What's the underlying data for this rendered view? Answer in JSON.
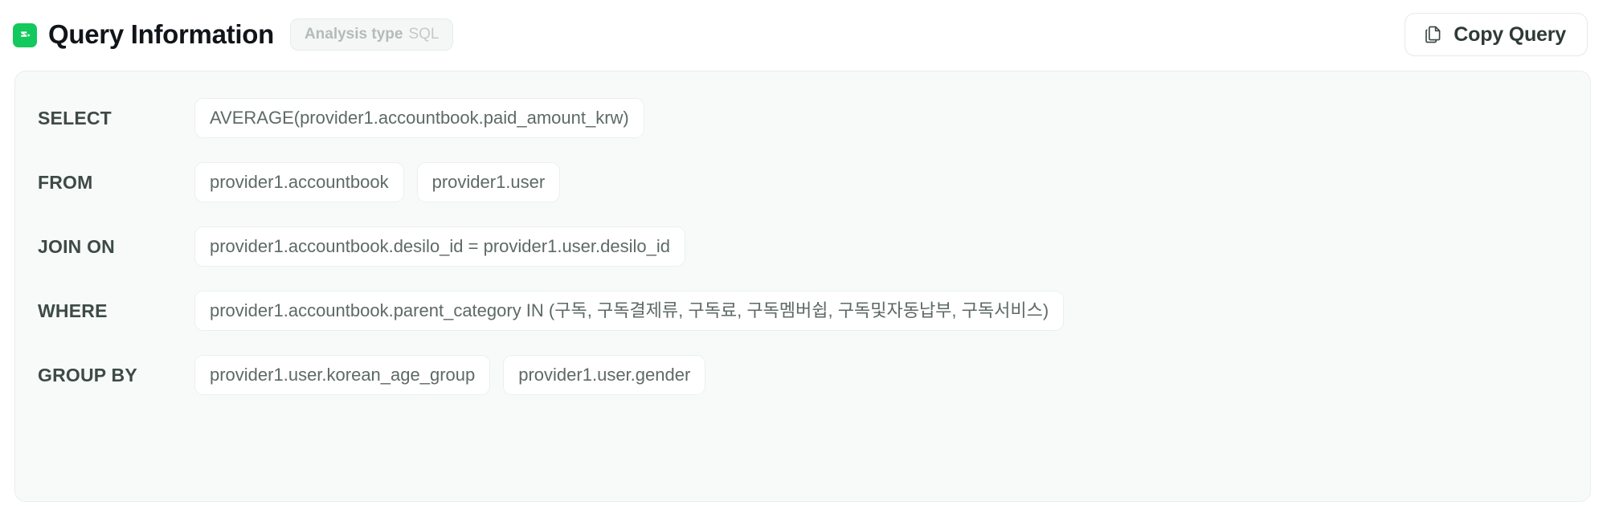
{
  "header": {
    "brand_icon": "query-logo-icon",
    "title": "Query Information",
    "badge": {
      "label": "Analysis type",
      "value": "SQL"
    },
    "copy_button": {
      "icon": "copy-icon",
      "label": "Copy Query"
    }
  },
  "query": {
    "rows": [
      {
        "label": "SELECT",
        "chips": [
          "AVERAGE(provider1.accountbook.paid_amount_krw)"
        ]
      },
      {
        "label": "FROM",
        "chips": [
          "provider1.accountbook",
          "provider1.user"
        ]
      },
      {
        "label": "JOIN ON",
        "chips": [
          "provider1.accountbook.desilo_id = provider1.user.desilo_id"
        ]
      },
      {
        "label": "WHERE",
        "chips": [
          "provider1.accountbook.parent_category IN (구독, 구독결제류, 구독료, 구독멤버쉽, 구독및자동납부, 구독서비스)"
        ]
      },
      {
        "label": "GROUP BY",
        "chips": [
          "provider1.user.korean_age_group",
          "provider1.user.gender"
        ]
      }
    ]
  },
  "colors": {
    "brand_green": "#13c85c",
    "card_bg": "#f7faf9",
    "card_border": "#e7efed",
    "chip_bg": "#ffffff",
    "chip_border": "#eaf0ee",
    "label_text": "#3e4a46",
    "chip_text": "#5d6a66",
    "title_text": "#111418"
  }
}
